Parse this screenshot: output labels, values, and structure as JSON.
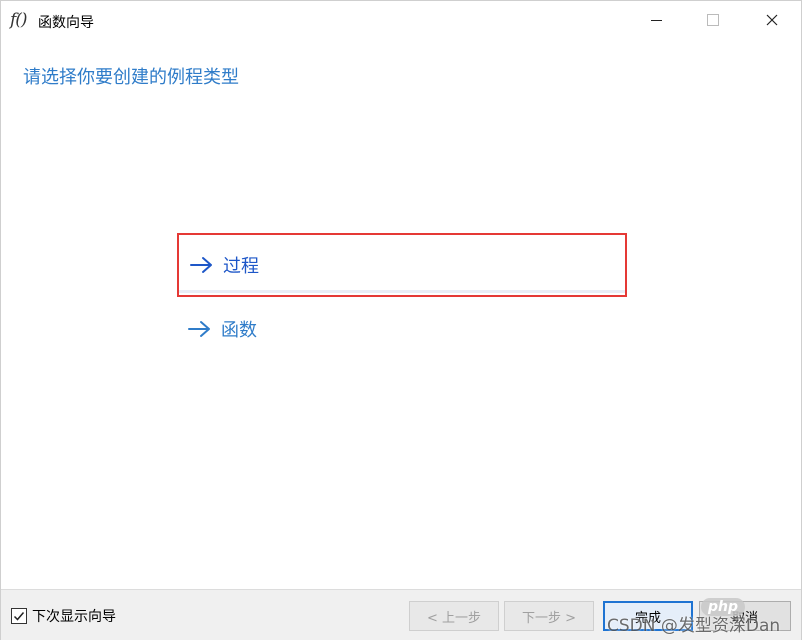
{
  "window": {
    "icon_text": "f()",
    "title": "函数向导"
  },
  "main": {
    "heading": "请选择你要创建的例程类型",
    "options": [
      {
        "arrow": "→",
        "label": "过程",
        "highlighted": true
      },
      {
        "arrow": "→",
        "label": "函数",
        "highlighted": false
      }
    ]
  },
  "footer": {
    "show_next_time_label": "下次显示向导",
    "show_next_time_checked": true,
    "prev_label": "< 上一步",
    "next_label": "下一步 >",
    "finish_label": "完成",
    "cancel_label": "取消"
  },
  "watermarks": {
    "php": "php",
    "csdn": "CSDN @发型资深Dan"
  },
  "colors": {
    "accent": "#2f7cc9",
    "link_dark": "#1e57c8",
    "highlight_border": "#e53935",
    "footer_bg": "#f0f0f0"
  },
  "icons": [
    "function-icon",
    "minimize-icon",
    "maximize-icon",
    "close-icon",
    "arrow-right-icon",
    "checkbox-check-icon"
  ]
}
